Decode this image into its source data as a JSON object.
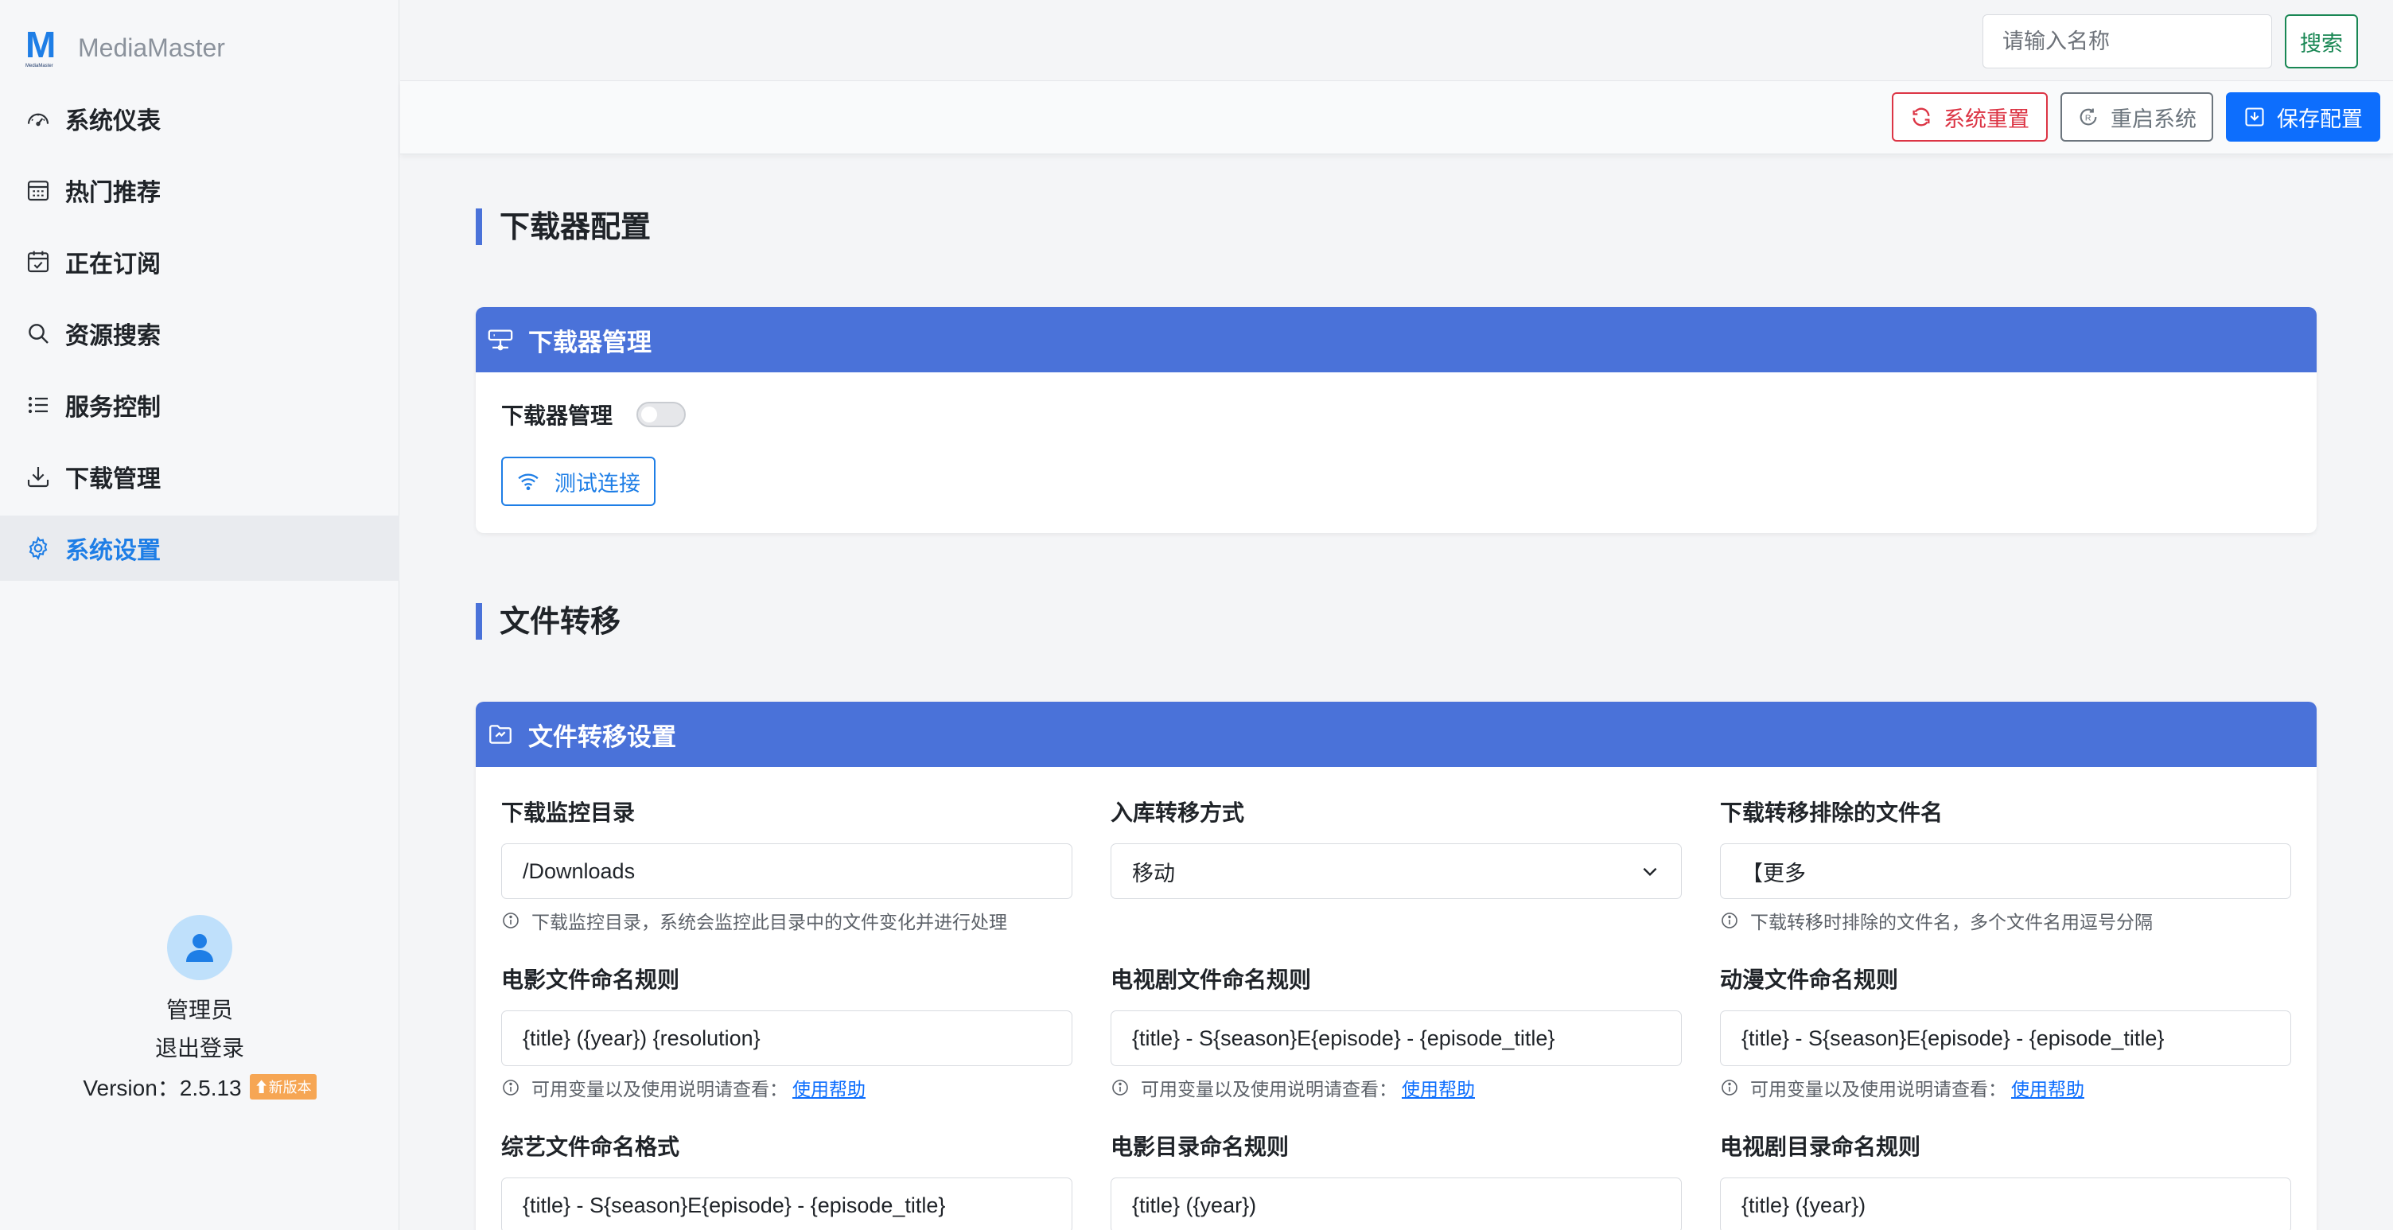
{
  "brand": {
    "name": "MediaMaster",
    "logo_letter": "M",
    "logo_sub": "MediaMaster"
  },
  "nav": [
    {
      "label": "系统仪表",
      "icon": "dashboard-icon"
    },
    {
      "label": "热门推荐",
      "icon": "calendar-grid-icon"
    },
    {
      "label": "正在订阅",
      "icon": "calendar-check-icon"
    },
    {
      "label": "资源搜索",
      "icon": "search-icon"
    },
    {
      "label": "服务控制",
      "icon": "list-icon"
    },
    {
      "label": "下载管理",
      "icon": "download-icon"
    },
    {
      "label": "系统设置",
      "icon": "gear-icon",
      "active": true
    }
  ],
  "user": {
    "name": "管理员",
    "logout": "退出登录",
    "version_label": "Version：2.5.13",
    "new_version_badge": "新版本"
  },
  "search": {
    "placeholder": "请输入名称",
    "button": "搜索"
  },
  "actions": {
    "reset": "系统重置",
    "restart": "重启系统",
    "save": "保存配置"
  },
  "sections": {
    "downloader": {
      "title": "下载器配置",
      "card_title": "下载器管理",
      "toggle_label": "下载器管理",
      "toggle_on": false,
      "test_button": "测试连接"
    },
    "transfer": {
      "title": "文件转移",
      "card_title": "文件转移设置",
      "fields": [
        {
          "label": "下载监控目录",
          "value": "/Downloads",
          "help": "下载监控目录，系统会监控此目录中的文件变化并进行处理"
        },
        {
          "label": "入库转移方式",
          "value": "移动",
          "type": "select"
        },
        {
          "label": "下载转移排除的文件名",
          "value": "【更多",
          "help": "下载转移时排除的文件名，多个文件名用逗号分隔"
        },
        {
          "label": "电影文件命名规则",
          "value": "{title} ({year}) {resolution}",
          "help": "可用变量以及使用说明请查看：",
          "link": "使用帮助"
        },
        {
          "label": "电视剧文件命名规则",
          "value": "{title} - S{season}E{episode} - {episode_title}",
          "help": "可用变量以及使用说明请查看：",
          "link": "使用帮助"
        },
        {
          "label": "动漫文件命名规则",
          "value": "{title} - S{season}E{episode} - {episode_title}",
          "help": "可用变量以及使用说明请查看：",
          "link": "使用帮助"
        },
        {
          "label": "综艺文件命名格式",
          "value": "{title} - S{season}E{episode} - {episode_title}"
        },
        {
          "label": "电影目录命名规则",
          "value": "{title} ({year})"
        },
        {
          "label": "电视剧目录命名规则",
          "value": "{title} ({year})"
        }
      ]
    }
  },
  "colors": {
    "accent": "#1e7ee6",
    "card_header": "#4a72d9",
    "danger": "#dc3545",
    "success": "#198754",
    "primary": "#0d6efd",
    "badge": "#f6a654"
  }
}
